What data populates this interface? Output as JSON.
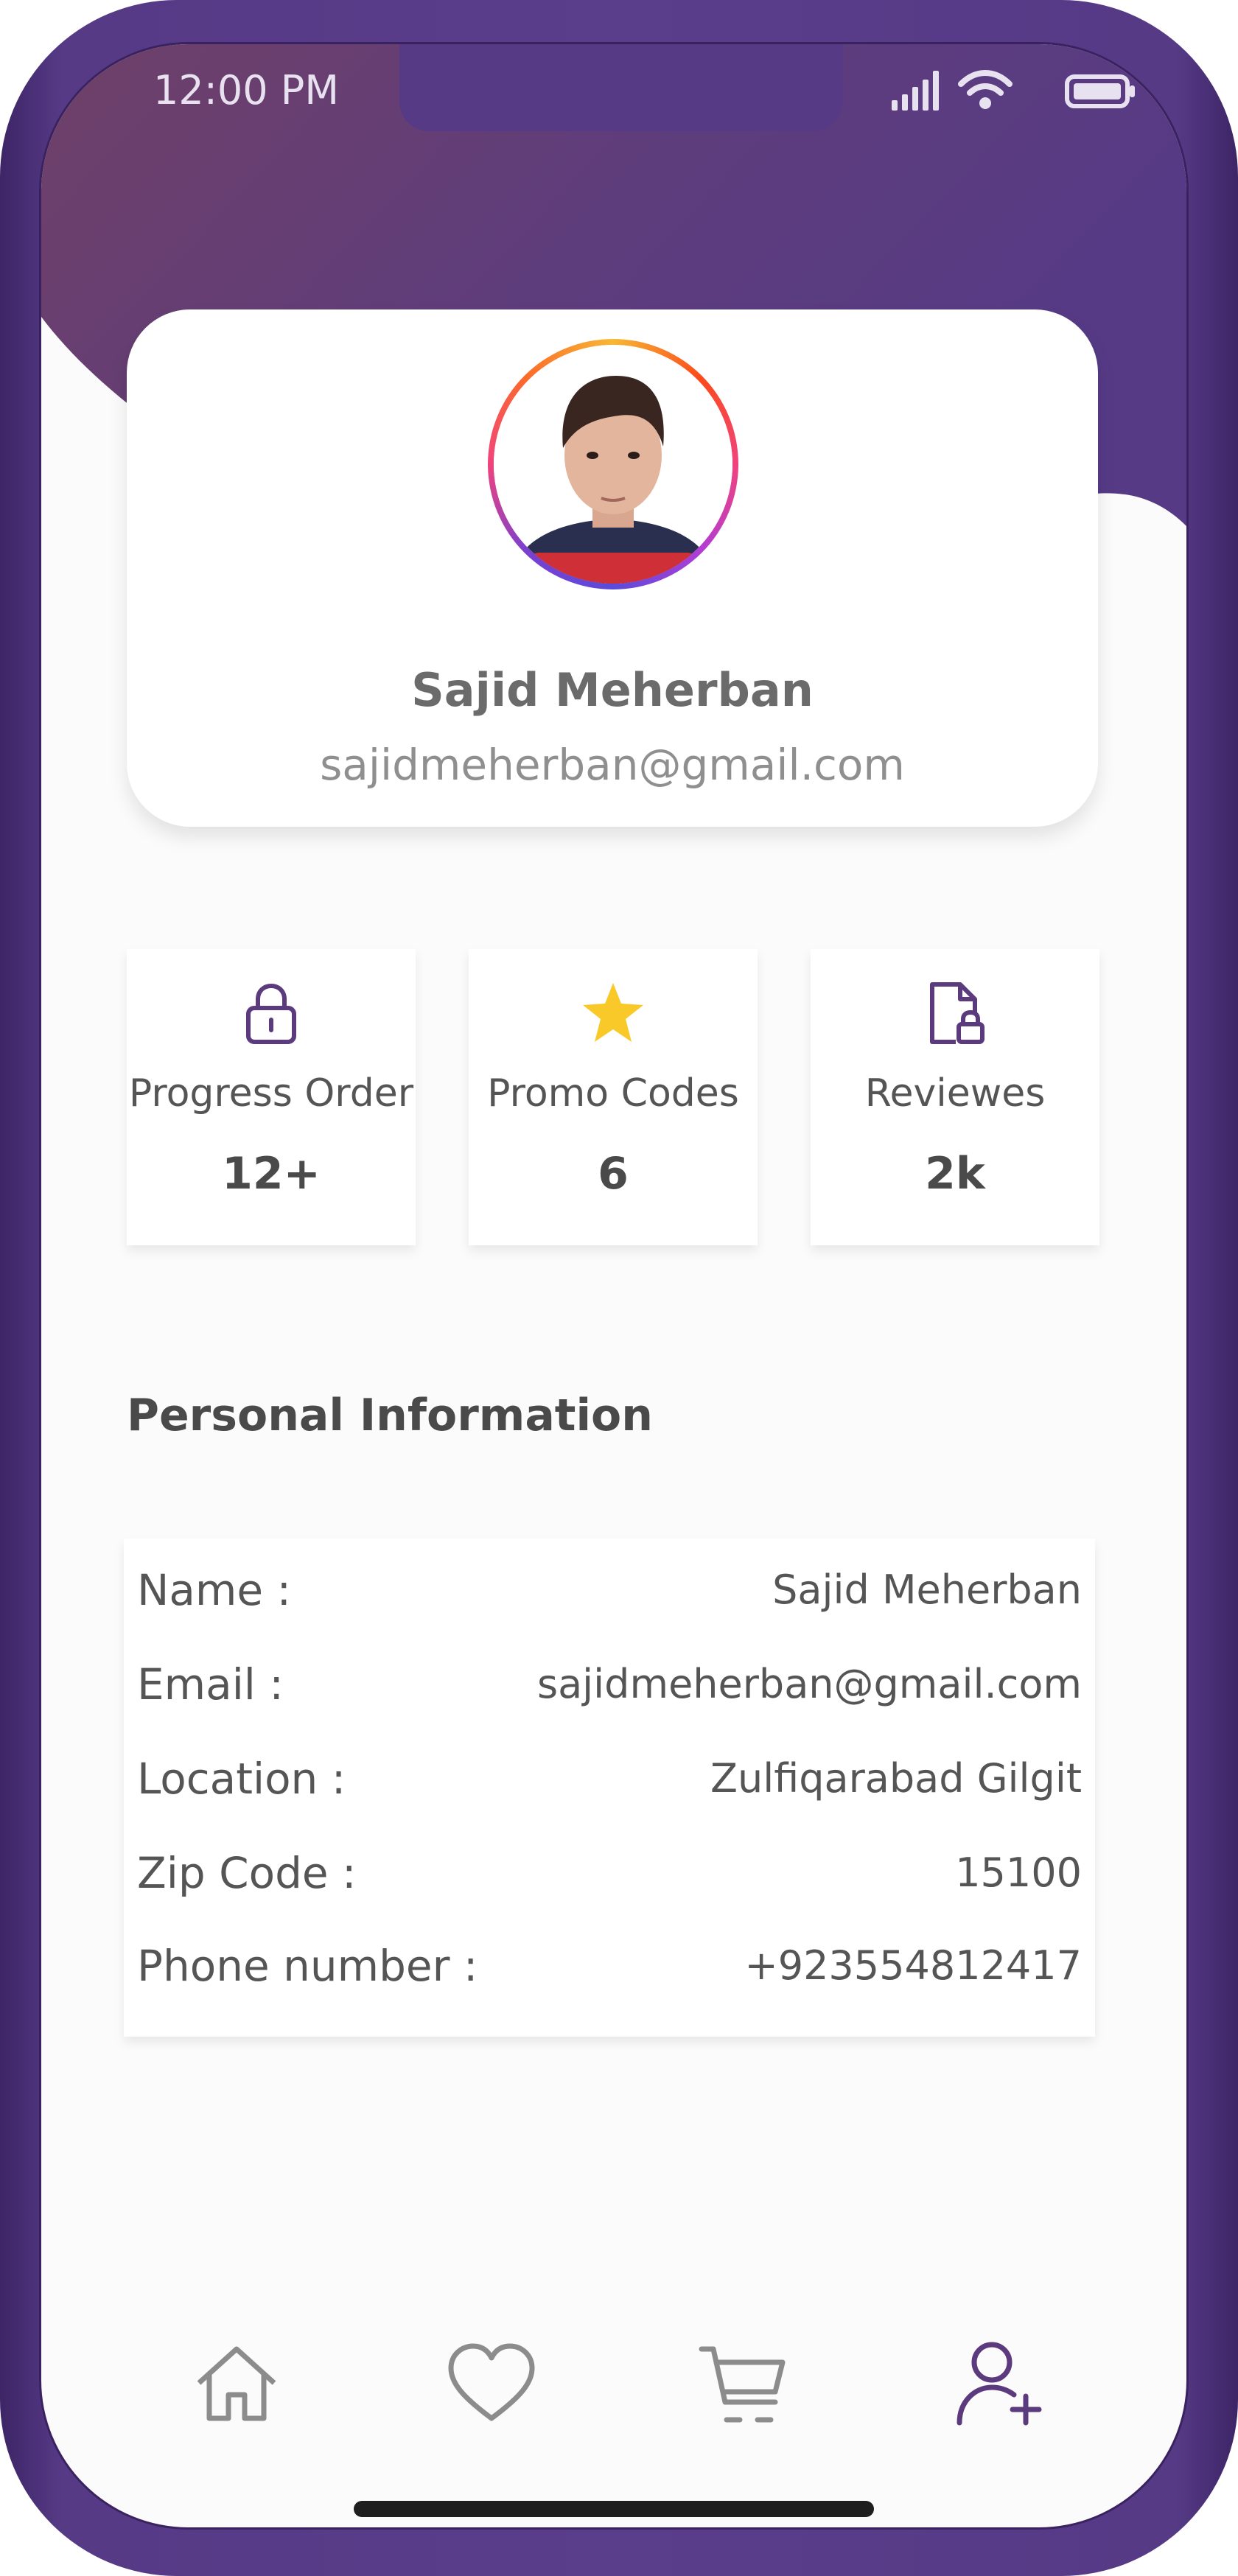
{
  "status_bar": {
    "time": "12:00 PM",
    "icons": [
      "signal-icon",
      "wifi-icon",
      "battery-icon"
    ]
  },
  "profile": {
    "name": "Sajid Meherban",
    "email": "sajidmeherban@gmail.com",
    "avatar": "profile-photo"
  },
  "stats": [
    {
      "icon": "lock-icon",
      "label": "Progress Order",
      "value": "12+"
    },
    {
      "icon": "star-icon",
      "label": "Promo Codes",
      "value": "6"
    },
    {
      "icon": "locked-document-icon",
      "label": "Reviewes",
      "value": "2k"
    }
  ],
  "personal_info": {
    "title": "Personal Information",
    "rows": [
      {
        "label": "Name :",
        "value": "Sajid Meherban"
      },
      {
        "label": "Email :",
        "value": "sajidmeherban@gmail.com"
      },
      {
        "label": "Location :",
        "value": "Zulfiqarabad Gilgit"
      },
      {
        "label": "Zip Code :",
        "value": "15100"
      },
      {
        "label": "Phone number :",
        "value": "+923554812417"
      }
    ]
  },
  "bottom_nav": {
    "items": [
      {
        "icon": "home-icon",
        "active": false
      },
      {
        "icon": "heart-icon",
        "active": false
      },
      {
        "icon": "cart-icon",
        "active": false
      },
      {
        "icon": "add-user-icon",
        "active": true
      }
    ]
  },
  "colors": {
    "brand_purple": "#563a86",
    "header_start": "#6f4068",
    "star_yellow": "#f9c929",
    "icon_purple": "#5b3a7e",
    "inactive_icon": "#8c8c8c"
  }
}
